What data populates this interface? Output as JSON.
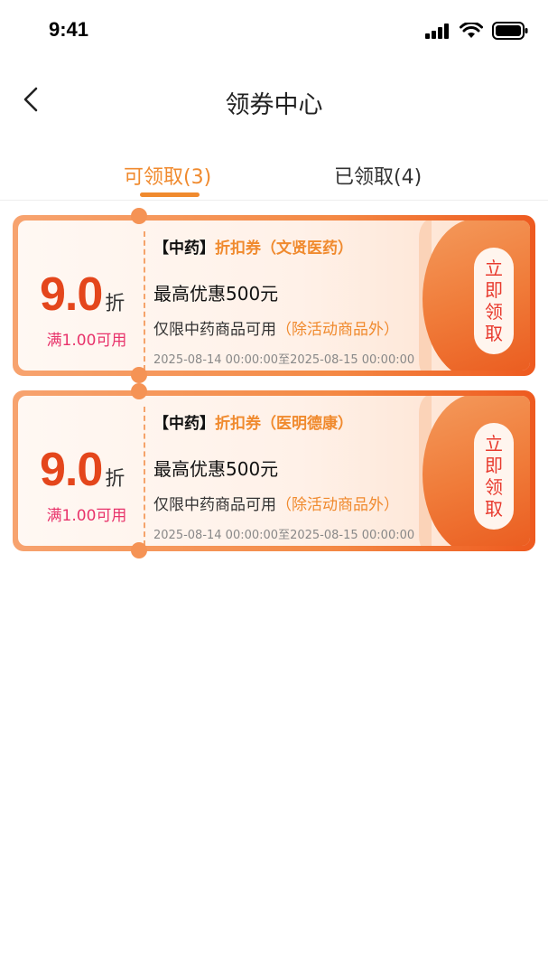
{
  "status_bar": {
    "time": "9:41",
    "icons": [
      "signal-icon",
      "wifi-icon",
      "battery-icon"
    ]
  },
  "nav": {
    "title": "领券中心",
    "back_icon": "chevron-left-icon"
  },
  "tabs": [
    {
      "label": "可领取(3)",
      "active": true
    },
    {
      "label": "已领取(4)",
      "active": false
    }
  ],
  "coupons": [
    {
      "discount_value": "9.0",
      "discount_unit": "折",
      "threshold": "满1.00可用",
      "category": "【中药】",
      "type": "折扣券（文贤医药）",
      "max_discount": "最高优惠500元",
      "scope": "仅限中药商品可用",
      "exclusion": "（除活动商品外）",
      "validity": "2025-08-14 00:00:00至2025-08-15 00:00:00",
      "claim_button": "立即领取"
    },
    {
      "discount_value": "9.0",
      "discount_unit": "折",
      "threshold": "满1.00可用",
      "category": "【中药】",
      "type": "折扣券（医明德康）",
      "max_discount": "最高优惠500元",
      "scope": "仅限中药商品可用",
      "exclusion": "（除活动商品外）",
      "validity": "2025-08-14 00:00:00至2025-08-15 00:00:00",
      "claim_button": "立即领取"
    }
  ],
  "colors": {
    "accent": "#f08a2e",
    "discount": "#e4461c",
    "threshold": "#e8336b",
    "button_text": "#e83a2e"
  }
}
